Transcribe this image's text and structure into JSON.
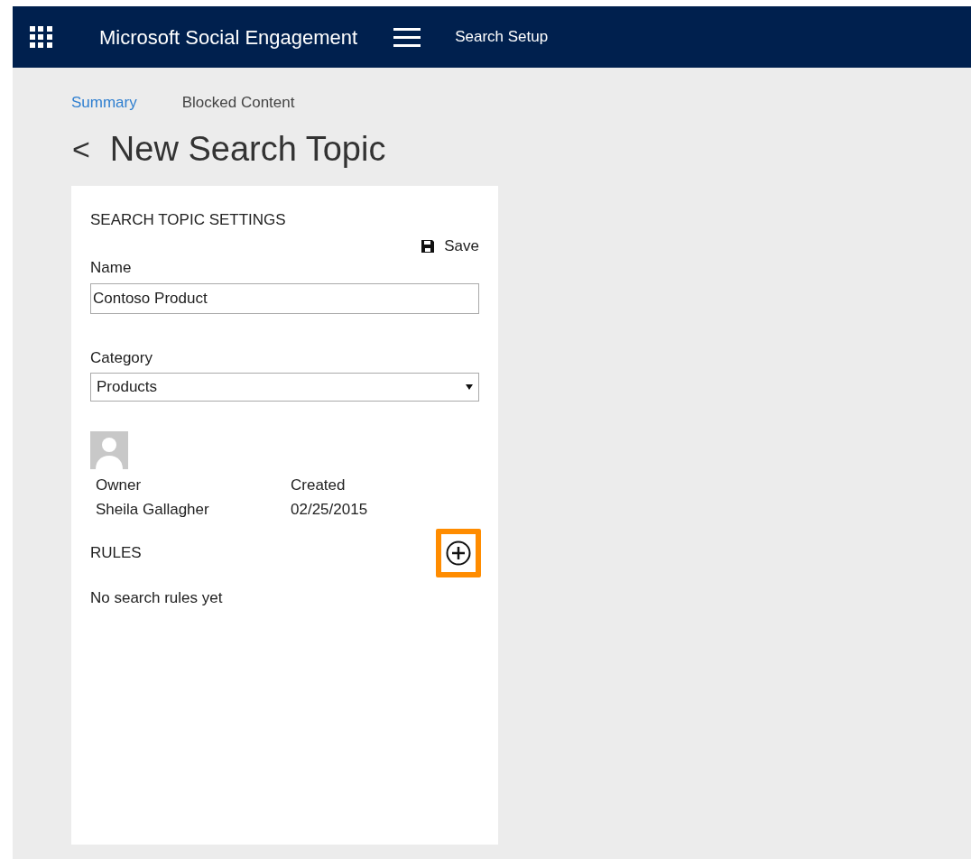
{
  "header": {
    "app_title": "Microsoft Social Engagement",
    "section": "Search Setup"
  },
  "tabs": [
    {
      "label": "Summary",
      "selected": true
    },
    {
      "label": "Blocked Content",
      "selected": false
    }
  ],
  "page_title": {
    "back": "<",
    "title": "New Search Topic"
  },
  "settings": {
    "heading": "SEARCH TOPIC SETTINGS",
    "save": "Save",
    "name_label": "Name",
    "name_value": "Contoso Product",
    "category_label": "Category",
    "category_value": "Products",
    "owner_label": "Owner",
    "owner_value": "Sheila Gallagher",
    "created_label": "Created",
    "created_value": "02/25/2015"
  },
  "rules": {
    "heading": "RULES",
    "add_highlighted": true,
    "empty_text": "No search rules yet"
  }
}
